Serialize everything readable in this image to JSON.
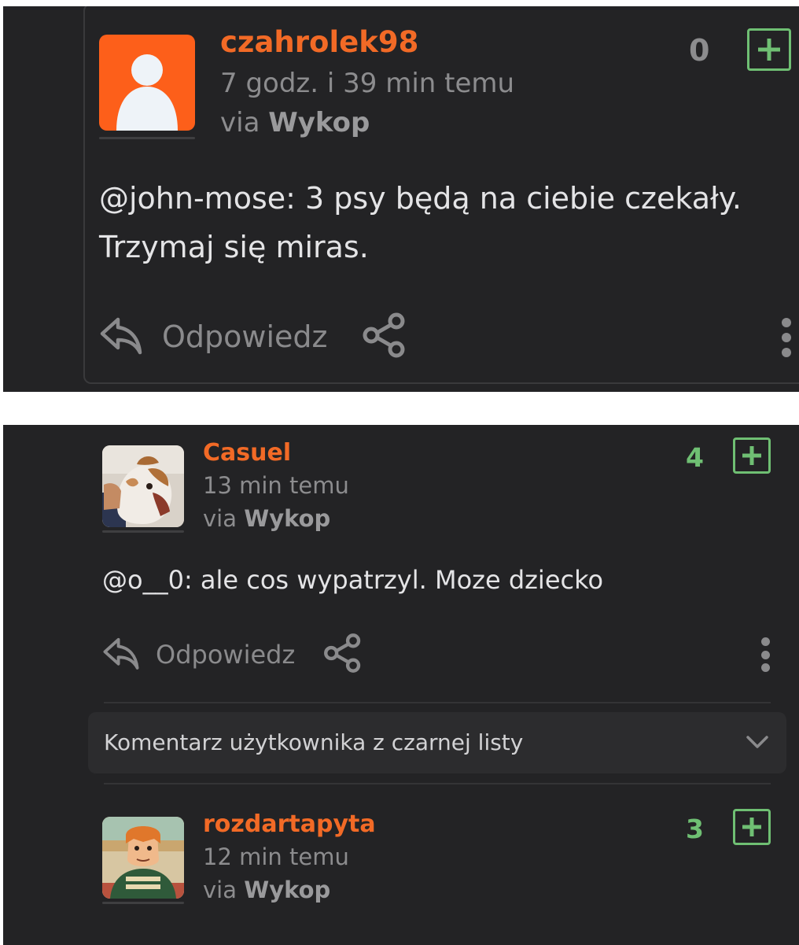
{
  "colors": {
    "background": "#232325",
    "username": "#f26a26",
    "vote_positive": "#6fbf73",
    "muted_text": "#8c8c8e",
    "body_text": "#e4e4e6"
  },
  "comment1": {
    "username": "czahrolek98",
    "time": "7 godz. i 39 min temu",
    "via_prefix": "via ",
    "via_source": "Wykop",
    "votes": "0",
    "text_line1": "@john-mose: 3 psy będą na ciebie czekały.",
    "text_line2": "Trzymaj się miras.",
    "reply_label": "Odpowiedz",
    "avatar": "default-user-avatar"
  },
  "comment2": {
    "username": "Casuel",
    "time": "13 min temu",
    "via_prefix": "via ",
    "via_source": "Wykop",
    "votes": "4",
    "text": "@o__0: ale cos wypatrzyl. Moze dziecko",
    "reply_label": "Odpowiedz",
    "avatar": "dog-photo-avatar"
  },
  "blacklist": {
    "label": "Komentarz użytkownika z czarnej listy",
    "icon": "chevron-down-icon"
  },
  "comment3": {
    "username": "rozdartapyta",
    "time": "12 min temu",
    "via_prefix": "via ",
    "via_source": "Wykop",
    "votes": "3",
    "avatar": "cartoon-character-avatar"
  }
}
